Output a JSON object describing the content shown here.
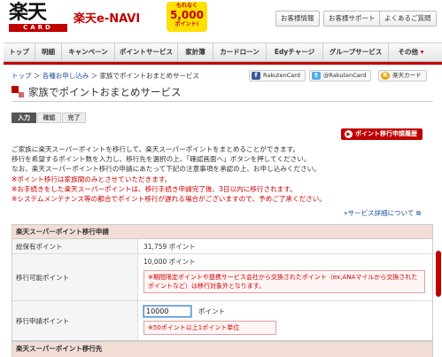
{
  "header": {
    "logo_main": "楽天",
    "logo_sub": "CARD",
    "navi_title": "楽天e-NAVI",
    "promo": {
      "line1": "もれなく",
      "points": "5,000",
      "line3": "ポイント!"
    },
    "utility_buttons": [
      "お客様情報",
      "お客様サポート",
      "よくあるご質問"
    ]
  },
  "nav": {
    "items": [
      "トップ",
      "明細",
      "キャンペーン",
      "ポイントサービス",
      "家計簿",
      "カードローン",
      "Edyチャージ",
      "グループサービス",
      "その他"
    ]
  },
  "breadcrumb": {
    "top": "トップ",
    "sep": "＞",
    "applications": "各種お申し込み",
    "current": "家族でポイントおまとめサービス"
  },
  "sns": {
    "facebook": "RakutenCard",
    "twitter": "@RakutenCard",
    "rakuten": "楽天カード"
  },
  "page_title": "家族でポイントおまとめサービス",
  "steps": [
    "入力",
    "確認",
    "完了"
  ],
  "history_button": "ポイント移行申請履歴",
  "description": {
    "lines": [
      "ご家族に楽天スーパーポイントを移行して、楽天スーパーポイントをまとめることができます。",
      "移行を希望するポイント数を入力し、移行先を選択の上、「確認画面へ」ボタンを押してください。",
      "なお、楽天スーパーポイント移行の申請にあたって下記の注意事項を承認の上、お申し込みください。"
    ],
    "notes": [
      "※ポイント移行は家族間のみとさせていただきます。",
      "※お手続きをした楽天スーパーポイントは、移行手続き申請完了後、3日以内に移行されます。",
      "※システムメンテナンス等の都合でポイント移行が遅れる場合がございますので、予めご了承ください。"
    ]
  },
  "detail_link": "サービス詳細について",
  "table": {
    "heading": "楽天スーパーポイント移行申請",
    "rows": {
      "held_label": "総保有ポイント",
      "held_value": "31,759 ポイント",
      "transferable_label": "移行可能ポイント",
      "transferable_value": "10,000 ポイント",
      "transferable_note": "※期間限定ポイントや提携サービス会社から交換されたポイント（ex,ANAマイルから交換されたポイントなど）は移行対象外となります。",
      "apply_label": "移行申請ポイント",
      "apply_value": "10000",
      "apply_unit": "ポイント",
      "apply_note": "※50ポイント以上1ポイント単位"
    }
  },
  "table2_heading": "楽天スーパーポイント移行先",
  "colors": {
    "brand": "#bf0000",
    "link": "#1a4fa3",
    "warning": "#cc0000"
  }
}
